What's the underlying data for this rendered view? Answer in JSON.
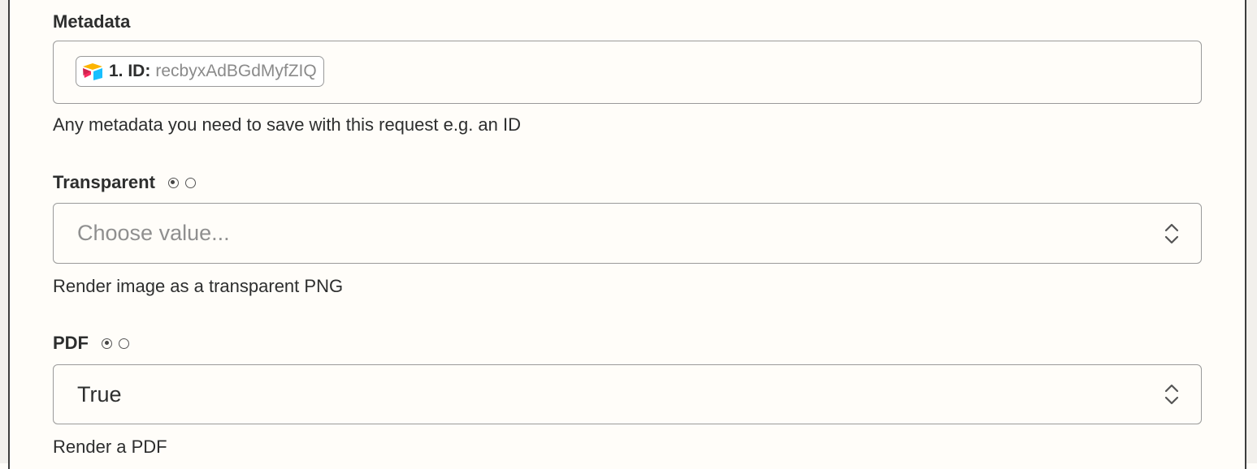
{
  "metadata": {
    "label": "Metadata",
    "pill": {
      "app_icon": "airtable-icon",
      "key": "1. ID:",
      "value": "recbyxAdBGdMyfZIQ"
    },
    "help": "Any metadata you need to save with this request e.g. an ID"
  },
  "transparent": {
    "label": "Transparent",
    "placeholder": "Choose value...",
    "help": "Render image as a transparent PNG"
  },
  "pdf": {
    "label": "PDF",
    "value": "True",
    "help": "Render a PDF"
  },
  "colors": {
    "border": "#9a9a9a",
    "background": "#fffdf9",
    "text": "#2d2e2e",
    "placeholder": "#8f8f8f"
  }
}
